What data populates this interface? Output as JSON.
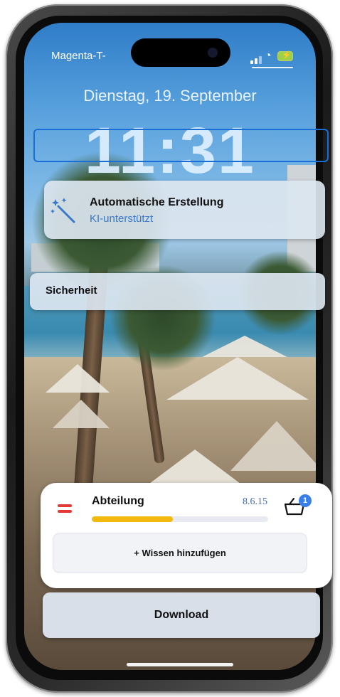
{
  "status_bar": {
    "carrier": "Magenta-T-",
    "wifi_icon": "wifi-icon",
    "battery_icon": "battery-charging-icon"
  },
  "lockscreen": {
    "date": "Dienstag, 19. September",
    "time": "11:31"
  },
  "auto_card": {
    "icon": "magic-wand-icon",
    "title": "Automatische Erstellung",
    "subtitle": "KI-unterstützt"
  },
  "security_card": {
    "label": "Sicherheit"
  },
  "department_panel": {
    "label": "Abteilung",
    "value": "8.6.15",
    "progress": 0.46,
    "progress_color": "#f2b90f",
    "flag_color": "#e53935",
    "basket_icon": "basket-icon",
    "badge_count": "1",
    "add_button": "+ Wissen hinzufügen"
  },
  "download_button": {
    "label": "Download"
  },
  "colors": {
    "accent": "#3a78c8",
    "highlight": "#1a6fd6",
    "badge": "#3a7ee8"
  }
}
